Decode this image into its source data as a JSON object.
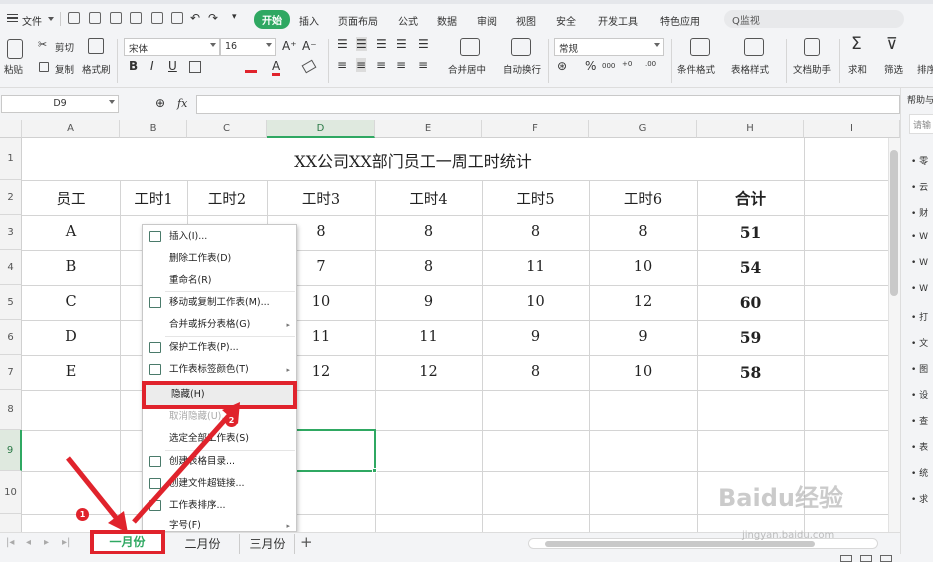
{
  "menubar": {
    "menu_icon": "hamburger-icon",
    "file_label": "文件",
    "tabs": [
      "开始",
      "插入",
      "页面布局",
      "公式",
      "数据",
      "审阅",
      "视图",
      "安全",
      "开发工具",
      "特色应用"
    ],
    "search_label": "Q监视",
    "active_tab_color": "#2fa862"
  },
  "ribbon": {
    "paste": "粘贴",
    "cut": "剪切",
    "copy": "复制",
    "format_painter": "格式刷",
    "font_name": "宋体",
    "font_size": "16",
    "bold": "B",
    "italic": "I",
    "underline": "U",
    "merge_center": "合并居中",
    "wrap_text": "自动换行",
    "number_format": "常规",
    "percent": "%",
    "thousands": "000",
    "cond_format": "条件格式",
    "table_style": "表格样式",
    "doc_assistant": "文档助手",
    "sum": "求和",
    "filter": "筛选",
    "sort": "排序"
  },
  "formula_bar": {
    "name_box": "D9",
    "fx": "fx",
    "value": ""
  },
  "sheet": {
    "columns": [
      "A",
      "B",
      "C",
      "D",
      "E",
      "F",
      "G",
      "H",
      "I"
    ],
    "rows": [
      "1",
      "2",
      "3",
      "4",
      "5",
      "6",
      "7",
      "8",
      "9",
      "10"
    ],
    "title": "XX公司XX部门员工一周工时统计",
    "header": [
      "员工",
      "工时1",
      "工时2",
      "工时3",
      "工时4",
      "工时5",
      "工时6",
      "合计"
    ],
    "data": [
      {
        "emp": "A",
        "d": "8",
        "e": "8",
        "f": "8",
        "g": "8",
        "h": "51"
      },
      {
        "emp": "B",
        "d": "7",
        "e": "8",
        "f": "11",
        "g": "10",
        "h": "54"
      },
      {
        "emp": "C",
        "d": "10",
        "e": "9",
        "f": "10",
        "g": "12",
        "h": "60"
      },
      {
        "emp": "D",
        "d": "11",
        "e": "11",
        "f": "9",
        "g": "9",
        "h": "59"
      },
      {
        "emp": "E",
        "d": "12",
        "e": "12",
        "f": "8",
        "g": "10",
        "h": "58"
      }
    ]
  },
  "context_menu": {
    "items": [
      {
        "label": "插入(I)...",
        "icon": "insert-sheet-icon"
      },
      {
        "label": "删除工作表(D)",
        "icon": ""
      },
      {
        "label": "重命名(R)",
        "icon": ""
      },
      {
        "label": "移动或复制工作表(M)...",
        "icon": "move-copy-icon"
      },
      {
        "label": "合并或拆分表格(G)",
        "icon": ""
      },
      {
        "label": "保护工作表(P)...",
        "icon": "protect-sheet-icon"
      },
      {
        "label": "工作表标签颜色(T)",
        "icon": "tab-color-icon"
      },
      {
        "label": "隐藏(H)",
        "icon": ""
      },
      {
        "label": "取消隐藏(U)...",
        "icon": ""
      },
      {
        "label": "选定全部工作表(S)",
        "icon": ""
      },
      {
        "label": "创建表格目录...",
        "icon": "create-toc-icon"
      },
      {
        "label": "创建文件超链接...",
        "icon": "hyperlink-icon"
      },
      {
        "label": "工作表排序...",
        "icon": "sort-sheets-icon"
      },
      {
        "label": "字号(F)",
        "icon": ""
      }
    ],
    "highlight_color": "#e0232c"
  },
  "sheet_tabs": {
    "tabs": [
      "一月份",
      "二月份",
      "三月份"
    ],
    "add": "+",
    "active_color": "#2fa862"
  },
  "side_panel": {
    "title": "帮助与",
    "search": "请输",
    "items": [
      "零",
      "云",
      "财",
      "W",
      "W",
      "W",
      "打",
      "文",
      "图",
      "设",
      "查",
      "表",
      "统",
      "求"
    ]
  },
  "annotations": {
    "step1": "1",
    "step2": "2"
  },
  "watermark": {
    "logo": "Baidu经验",
    "url": "jingyan.baidu.com"
  }
}
